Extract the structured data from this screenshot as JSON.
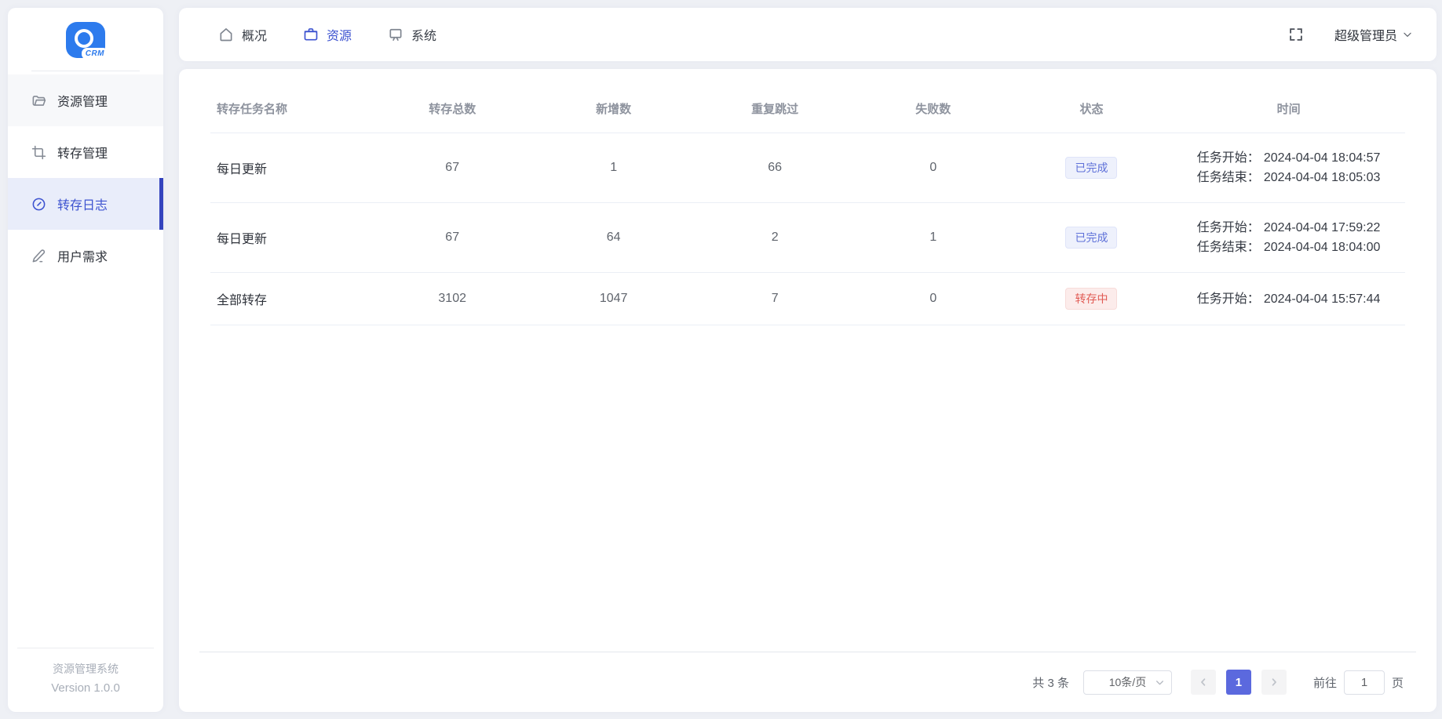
{
  "colors": {
    "page_bg": "#eef0f5",
    "card_bg": "#ffffff",
    "accent": "#3d53d0",
    "active_item_bg": "#e9edfa",
    "active_bar": "#3444bd",
    "header_text": "#8e939e",
    "cell_text": "#5f646c",
    "dark_text": "#303133",
    "muted_text": "#a8aeb8",
    "border": "#ebeef5",
    "badge_completed_text": "#5f71d9",
    "badge_completed_bg": "#eef1fc",
    "badge_running_text": "#e15b55",
    "badge_running_bg": "#fceceb",
    "pager_active_bg": "#5b69de"
  },
  "sidebar": {
    "logo_text": "CRM",
    "items": [
      {
        "label": "资源管理",
        "icon": "folder-icon"
      },
      {
        "label": "转存管理",
        "icon": "crop-icon"
      },
      {
        "label": "转存日志",
        "icon": "compass-icon",
        "active": true
      },
      {
        "label": "用户需求",
        "icon": "edit-icon"
      }
    ],
    "footer": {
      "line1": "资源管理系统",
      "line2": "Version 1.0.0"
    }
  },
  "topbar": {
    "tabs": [
      {
        "label": "概况",
        "icon": "home-icon"
      },
      {
        "label": "资源",
        "icon": "briefcase-icon",
        "active": true
      },
      {
        "label": "系统",
        "icon": "monitor-icon"
      }
    ],
    "user_name": "超级管理员"
  },
  "table": {
    "columns": [
      "转存任务名称",
      "转存总数",
      "新增数",
      "重复跳过",
      "失败数",
      "状态",
      "时间"
    ],
    "rows": [
      {
        "name": "每日更新",
        "total": "67",
        "added": "1",
        "skipped": "66",
        "failed": "0",
        "status": {
          "label": "已完成",
          "type": "completed"
        },
        "times": [
          {
            "label": "任务开始：",
            "value": "2024-04-04 18:04:57"
          },
          {
            "label": "任务结束：",
            "value": "2024-04-04 18:05:03"
          }
        ]
      },
      {
        "name": "每日更新",
        "total": "67",
        "added": "64",
        "skipped": "2",
        "failed": "1",
        "status": {
          "label": "已完成",
          "type": "completed"
        },
        "times": [
          {
            "label": "任务开始：",
            "value": "2024-04-04 17:59:22"
          },
          {
            "label": "任务结束：",
            "value": "2024-04-04 18:04:00"
          }
        ]
      },
      {
        "name": "全部转存",
        "total": "3102",
        "added": "1047",
        "skipped": "7",
        "failed": "0",
        "status": {
          "label": "转存中",
          "type": "running"
        },
        "times": [
          {
            "label": "任务开始：",
            "value": "2024-04-04 15:57:44"
          }
        ]
      }
    ]
  },
  "pagination": {
    "total_text": "共 3 条",
    "page_size": "10条/页",
    "active_page": "1",
    "goto_label": "前往",
    "goto_value": "1",
    "goto_suffix": "页"
  }
}
